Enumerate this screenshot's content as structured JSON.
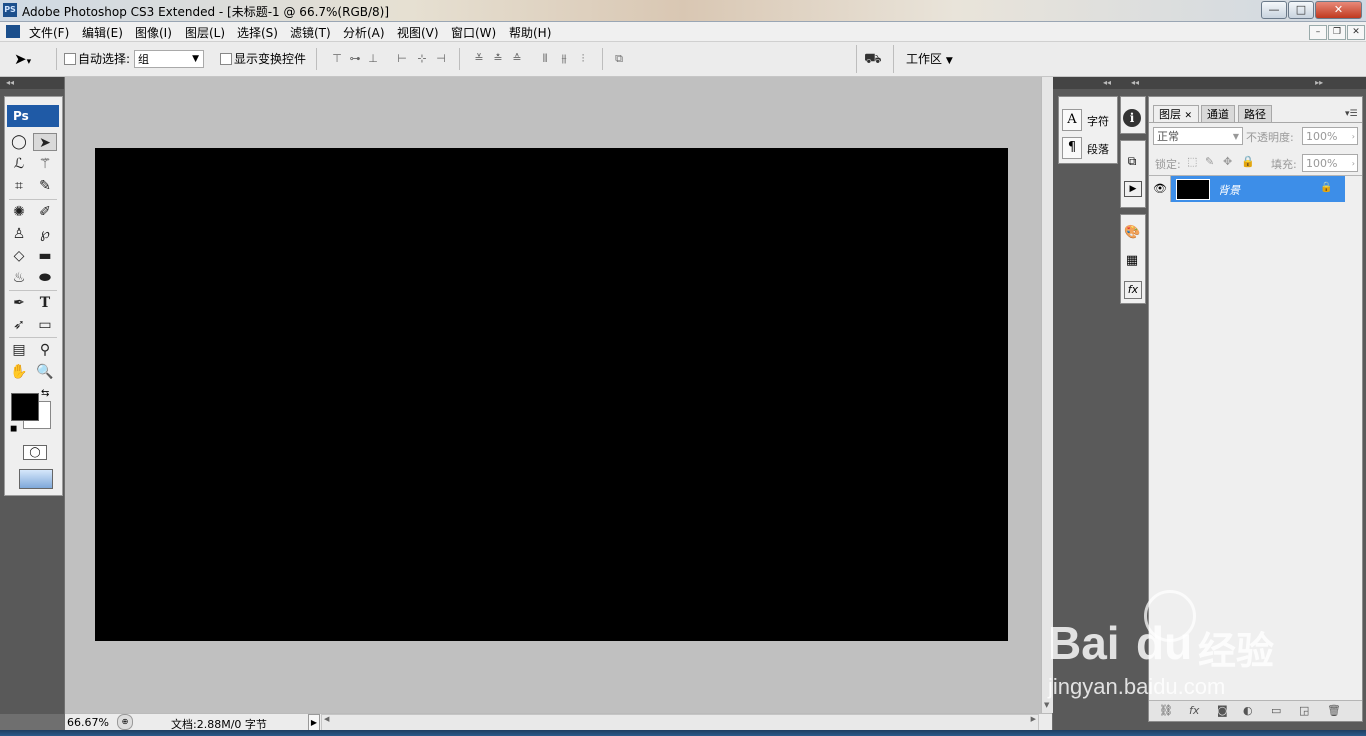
{
  "window": {
    "app_icon": "PS",
    "title": "Adobe Photoshop CS3 Extended - [未标题-1 @ 66.7%(RGB/8)]",
    "controls": {
      "minimize": "—",
      "maximize": "□",
      "close": "✕"
    }
  },
  "menu": {
    "items": [
      "文件(F)",
      "编辑(E)",
      "图像(I)",
      "图层(L)",
      "选择(S)",
      "滤镜(T)",
      "分析(A)",
      "视图(V)",
      "窗口(W)",
      "帮助(H)"
    ],
    "doc_controls": {
      "minimize": "–",
      "restore": "❐",
      "close": "✕"
    }
  },
  "options_bar": {
    "auto_select_label": "自动选择:",
    "auto_select_value": "组",
    "show_transform_label": "显示变换控件",
    "workspace_label": "工作区"
  },
  "toolbox": {
    "logo": "Ps",
    "foreground_color": "#000000",
    "background_color": "#ffffff"
  },
  "status": {
    "zoom": "66.67%",
    "doc_info": "文档:2.88M/0 字节"
  },
  "mini_panels": {
    "character": "字符",
    "paragraph": "段落"
  },
  "layers_panel": {
    "tabs": [
      "图层",
      "通道",
      "路径"
    ],
    "blend_mode": "正常",
    "opacity_label": "不透明度:",
    "opacity_value": "100%",
    "lock_label": "锁定:",
    "fill_label": "填充:",
    "fill_value": "100%",
    "layer_name": "背景",
    "selected_color": "#3d8ee8"
  },
  "watermark": {
    "brand": "Bai",
    "brand2": "du",
    "chinese": "经验",
    "url": "jingyan.baidu.com"
  }
}
